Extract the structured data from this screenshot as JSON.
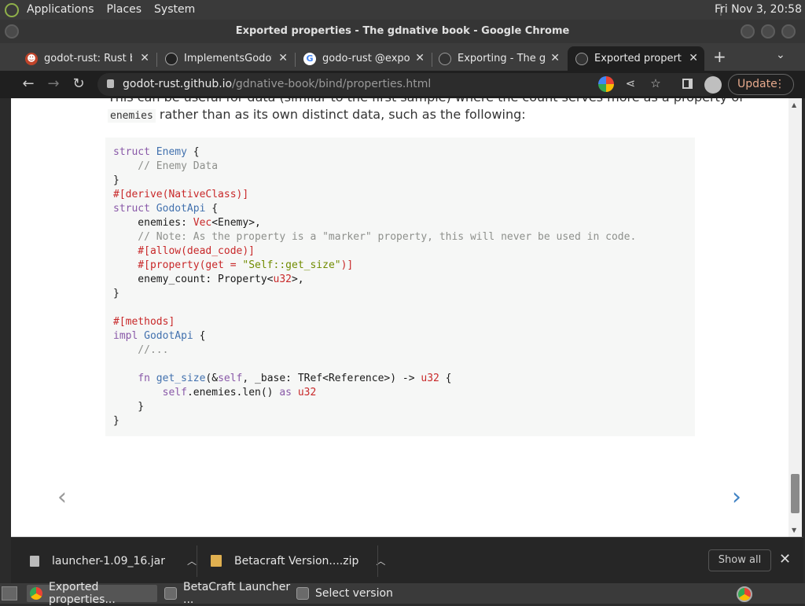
{
  "top_panel": {
    "menus": [
      "Applications",
      "Places",
      "System"
    ],
    "clock": "Fri Nov 3, 20:58"
  },
  "window": {
    "title": "Exported properties - The gdnative book - Google Chrome"
  },
  "tabs": [
    {
      "label": "godot-rust: Rust bi",
      "favicon": "godot-icon",
      "active": false
    },
    {
      "label": "ImplementsGodotA",
      "favicon": "github-icon",
      "active": false
    },
    {
      "label": "godo-rust @export",
      "favicon": "google-icon",
      "active": false
    },
    {
      "label": "Exporting - The gd",
      "favicon": "book-icon",
      "active": false
    },
    {
      "label": "Exported propertie",
      "favicon": "book-icon",
      "active": true
    }
  ],
  "toolbar": {
    "url_host": "godot-rust.github.io",
    "url_path": "/gdnative-book/bind/properties.html",
    "update_label": "Update"
  },
  "page": {
    "para_line1": "This can be useful for data (similar to the first sample) where the count serves more as a property of",
    "para_code": "enemies",
    "para_line2_rest": " rather than as its own distinct data, such as the following:"
  },
  "code": {
    "lines": [
      "struct Enemy {",
      "    // Enemy Data",
      "}",
      "#[derive(NativeClass)]",
      "struct GodotApi {",
      "    enemies: Vec<Enemy>,",
      "    // Note: As the property is a \"marker\" property, this will never be used in code.",
      "    #[allow(dead_code)]",
      "    #[property(get = \"Self::get_size\")]",
      "    enemy_count: Property<u32>,",
      "}",
      "",
      "#[methods]",
      "impl GodotApi {",
      "    //...",
      "",
      "    fn get_size(&self, _base: TRef<Reference>) -> u32 {",
      "        self.enemies.len() as u32",
      "    }",
      "}"
    ]
  },
  "downloads": [
    {
      "name": "launcher-1.09_16.jar",
      "icon": "file-icon"
    },
    {
      "name": "Betacraft Version....zip",
      "icon": "zip-icon"
    }
  ],
  "download_bar": {
    "show_all": "Show all"
  },
  "taskbar": [
    {
      "label": "Exported properties...",
      "icon": "chrome-icon",
      "active": true
    },
    {
      "label": "BetaCraft Launcher ...",
      "icon": "java-icon",
      "active": false
    },
    {
      "label": "Select version",
      "icon": "java-icon",
      "active": false
    }
  ],
  "colors": {
    "accent_next": "#4183c4",
    "update": "#e6a98c"
  }
}
